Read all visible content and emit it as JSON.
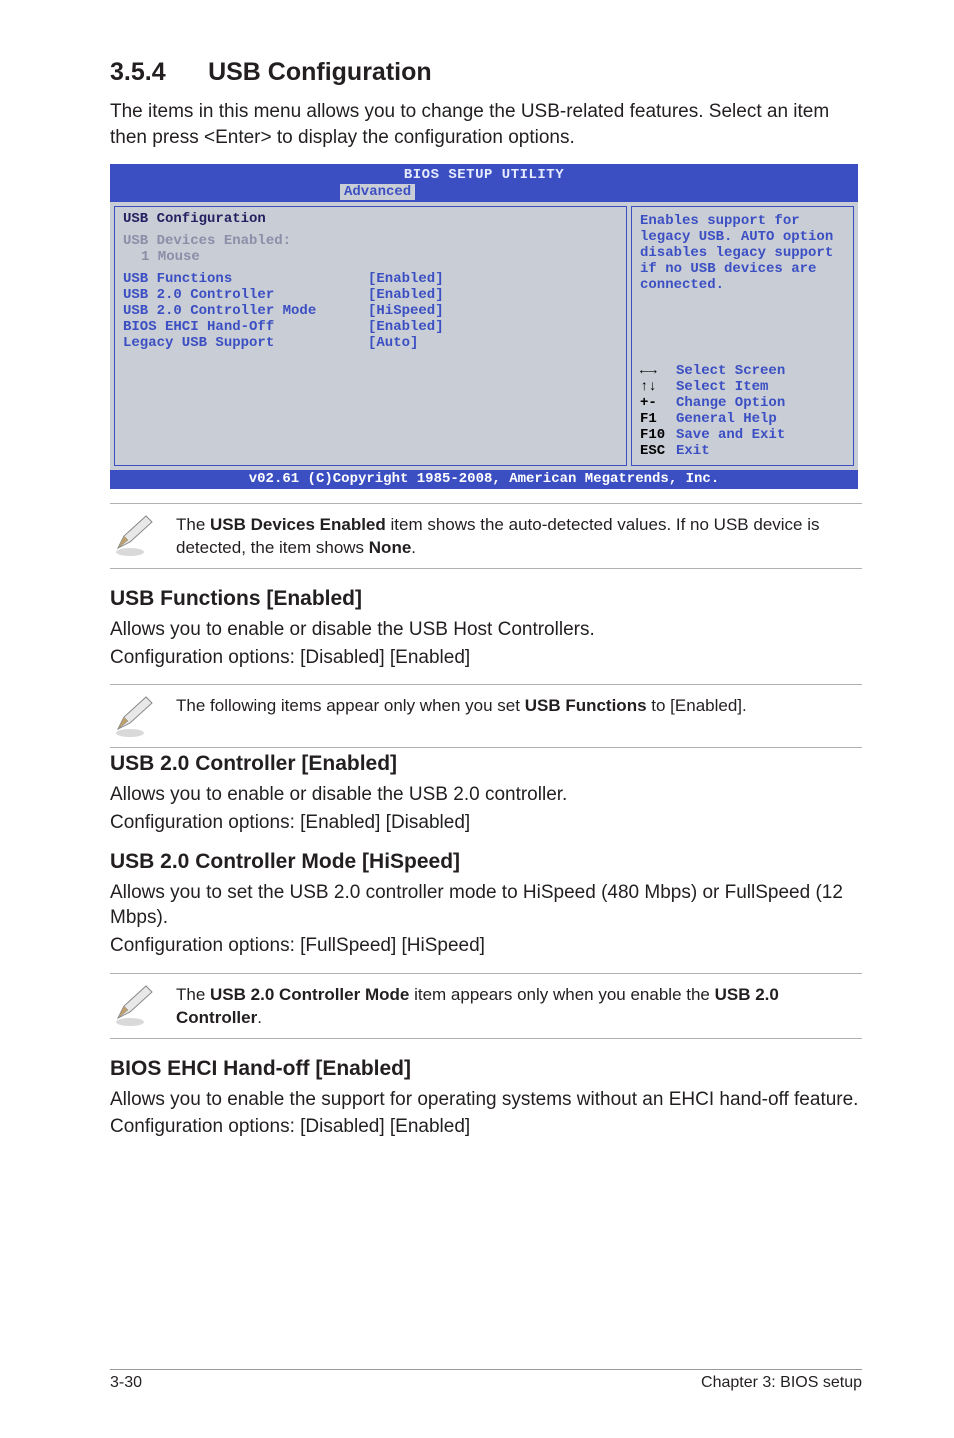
{
  "section": {
    "number": "3.5.4",
    "title": "USB Configuration"
  },
  "intro": "The items in this menu allows you to change the USB-related features. Select an item then press <Enter> to display the configuration options.",
  "bios": {
    "title": "BIOS SETUP UTILITY",
    "tab": "Advanced",
    "panel_title": "USB Configuration",
    "devices_label": "USB Devices Enabled:",
    "devices_value": "1 Mouse",
    "rows": [
      {
        "k": "USB Functions",
        "v": "[Enabled]"
      },
      {
        "k": "USB 2.0 Controller",
        "v": "[Enabled]"
      },
      {
        "k": "USB 2.0 Controller Mode",
        "v": "[HiSpeed]"
      },
      {
        "k": "BIOS EHCI Hand-Off",
        "v": "[Enabled]"
      },
      {
        "k": "Legacy USB Support",
        "v": "[Auto]"
      }
    ],
    "help": "Enables support for legacy USB. AUTO option disables legacy support if no USB devices are connected.",
    "nav": [
      {
        "sym": "←→",
        "label": "Select Screen"
      },
      {
        "sym": "↑↓",
        "label": "Select Item"
      },
      {
        "sym": "+-",
        "label": "Change Option"
      },
      {
        "sym": "F1",
        "label": "General Help"
      },
      {
        "sym": "F10",
        "label": "Save and Exit"
      },
      {
        "sym": "ESC",
        "label": "Exit"
      }
    ],
    "footer": "v02.61 (C)Copyright 1985-2008, American Megatrends, Inc."
  },
  "notes": {
    "n1_a": "The ",
    "n1_b": "USB Devices Enabled",
    "n1_c": " item shows the auto-detected values. If no USB device is detected, the item shows ",
    "n1_d": "None",
    "n1_e": ".",
    "n2_a": "The following items appear only when you set ",
    "n2_b": "USB Functions",
    "n2_c": " to [Enabled].",
    "n3_a": "The ",
    "n3_b": "USB 2.0 Controller Mode",
    "n3_c": " item appears only when you enable the ",
    "n3_d": "USB 2.0 Controller",
    "n3_e": "."
  },
  "subs": {
    "s1_title": "USB Functions [Enabled]",
    "s1_p1": "Allows you to enable or disable the USB Host Controllers.",
    "s1_p2": "Configuration options: [Disabled] [Enabled]",
    "s2_title": "USB 2.0 Controller [Enabled]",
    "s2_p1": "Allows you to enable or disable the USB 2.0 controller.",
    "s2_p2": "Configuration options: [Enabled] [Disabled]",
    "s3_title": "USB 2.0 Controller Mode [HiSpeed]",
    "s3_p1": "Allows you to set the USB 2.0 controller mode to HiSpeed (480 Mbps) or FullSpeed (12 Mbps).",
    "s3_p2": "Configuration options: [FullSpeed] [HiSpeed]",
    "s4_title": "BIOS EHCI Hand-off [Enabled]",
    "s4_p1": "Allows you to enable the support for operating systems without an EHCI hand-off feature.",
    "s4_p2": "Configuration options: [Disabled] [Enabled]"
  },
  "footer": {
    "left": "3-30",
    "right": "Chapter 3: BIOS setup"
  }
}
